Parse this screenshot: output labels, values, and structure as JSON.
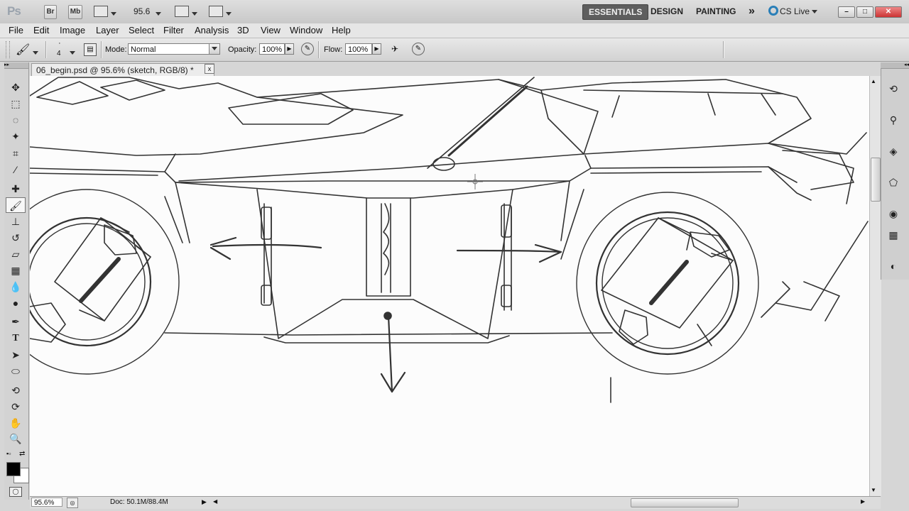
{
  "app": {
    "logo": "Ps",
    "bridge_label": "Br",
    "mini_bridge_label": "Mb",
    "zoom_value": "95.6",
    "workspaces": [
      "ESSENTIALS",
      "DESIGN",
      "PAINTING"
    ],
    "more_workspaces": "»",
    "cs_live": "CS Live",
    "window_buttons": [
      "–",
      "□",
      "✕"
    ]
  },
  "menu": [
    "File",
    "Edit",
    "Image",
    "Layer",
    "Select",
    "Filter",
    "Analysis",
    "3D",
    "View",
    "Window",
    "Help"
  ],
  "options": {
    "brush_size": "4",
    "mode_label": "Mode:",
    "mode_value": "Normal",
    "opacity_label": "Opacity:",
    "opacity_value": "100%",
    "flow_label": "Flow:",
    "flow_value": "100%"
  },
  "document": {
    "tab_title": "06_begin.psd @ 95.6% (sketch, RGB/8) *",
    "close_label": "x"
  },
  "status": {
    "zoom": "95.6%",
    "doc_info": "Doc: 50.1M/88.4M"
  },
  "colors": {
    "foreground": "#000000",
    "background": "#ffffff",
    "active_workspace": "#5e5e5e"
  }
}
